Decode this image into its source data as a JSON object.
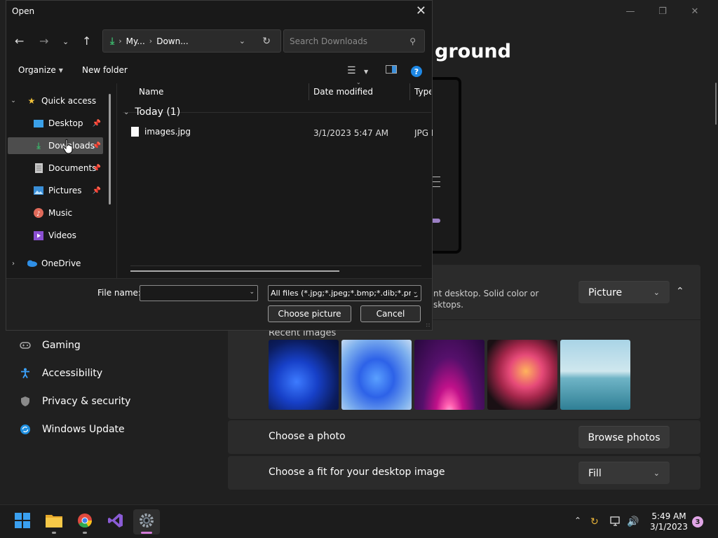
{
  "settings": {
    "page_title": "ground",
    "window_controls": [
      "—",
      "❐",
      "✕"
    ],
    "background_desc": "nt desktop. Solid color or\nsktops.",
    "background_type": "Picture",
    "recent_images_label": "Recent images",
    "choose_photo_label": "Choose a photo",
    "browse_label": "Browse photos",
    "fit_label": "Choose a fit for your desktop image",
    "fit_value": "Fill",
    "nav": [
      {
        "label": "Gaming",
        "icon": "gamepad-icon"
      },
      {
        "label": "Accessibility",
        "icon": "accessibility-icon"
      },
      {
        "label": "Privacy & security",
        "icon": "shield-icon"
      },
      {
        "label": "Windows Update",
        "icon": "update-icon"
      }
    ]
  },
  "dialog": {
    "title": "Open",
    "address": {
      "part1": "My...",
      "part2": "Down..."
    },
    "search_placeholder": "Search Downloads",
    "organize": "Organize",
    "new_folder": "New folder",
    "tree": [
      {
        "label": "Quick access",
        "icon": "star-icon"
      },
      {
        "label": "Desktop",
        "icon": "desktop-icon"
      },
      {
        "label": "Downloads",
        "icon": "download-icon"
      },
      {
        "label": "Documents",
        "icon": "documents-icon"
      },
      {
        "label": "Pictures",
        "icon": "pictures-icon"
      },
      {
        "label": "Music",
        "icon": "music-icon"
      },
      {
        "label": "Videos",
        "icon": "videos-icon"
      },
      {
        "label": "OneDrive",
        "icon": "cloud-icon"
      }
    ],
    "columns": {
      "name": "Name",
      "date": "Date modified",
      "type": "Type"
    },
    "group": "Today (1)",
    "files": [
      {
        "name": "images.jpg",
        "date": "3/1/2023 5:47 AM",
        "type": "JPG File"
      }
    ],
    "file_name_label": "File name:",
    "file_name_value": "",
    "filter": "All files (*.jpg;*.jpeg;*.bmp;*.dib;*.png",
    "choose_label": "Choose picture",
    "cancel_label": "Cancel"
  },
  "taskbar": {
    "time": "5:49 AM",
    "date": "3/1/2023",
    "notifications": "3"
  }
}
